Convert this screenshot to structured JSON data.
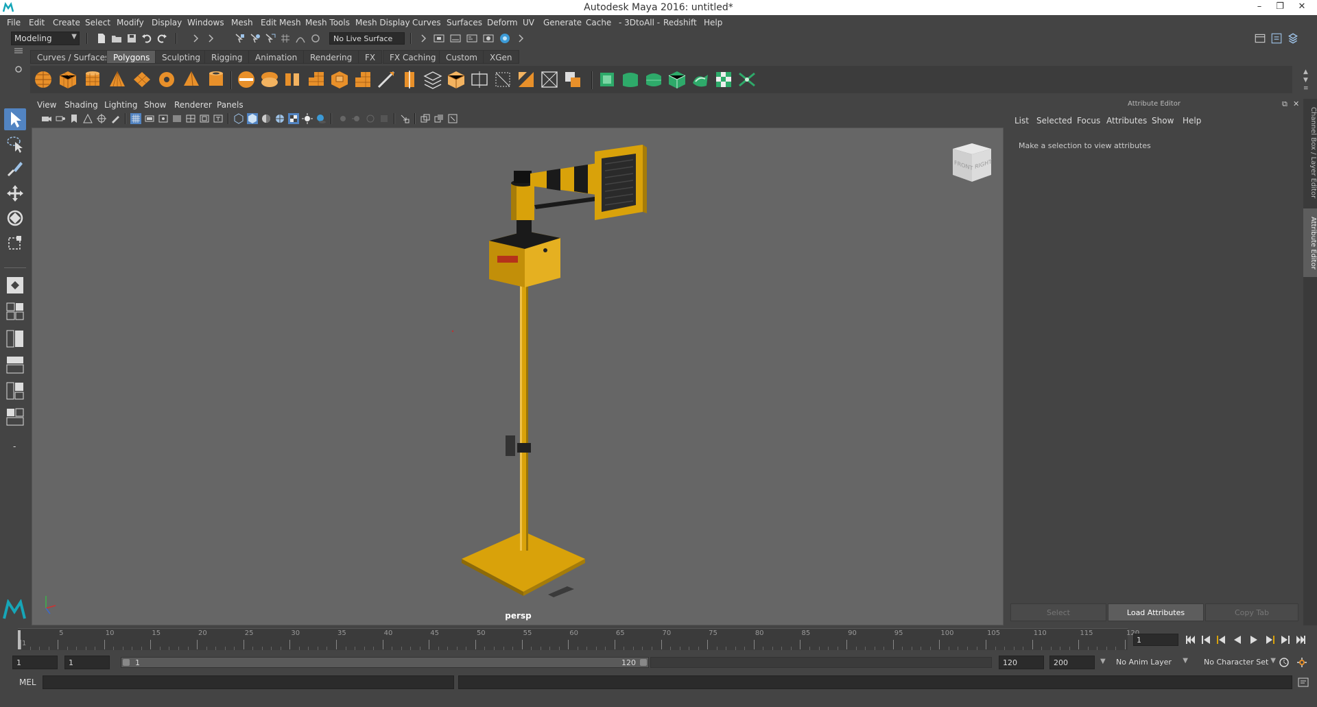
{
  "window": {
    "title": "Autodesk Maya 2016: untitled*"
  },
  "menubar": [
    "File",
    "Edit",
    "Create",
    "Select",
    "Modify",
    "Display",
    "Windows",
    "Mesh",
    "Edit Mesh",
    "Mesh Tools",
    "Mesh Display",
    "Curves",
    "Surfaces",
    "Deform",
    "UV",
    "Generate",
    "Cache",
    "- 3DtoAll -",
    "Redshift",
    "Help"
  ],
  "status": {
    "mode": "Modeling",
    "live_surface": "No Live Surface"
  },
  "shelf": {
    "tabs": [
      "Curves / Surfaces",
      "Polygons",
      "Sculpting",
      "Rigging",
      "Animation",
      "Rendering",
      "FX",
      "FX Caching",
      "Custom",
      "XGen"
    ],
    "active_tab": "Polygons"
  },
  "viewport": {
    "menu": [
      "View",
      "Shading",
      "Lighting",
      "Show",
      "Renderer",
      "Panels"
    ],
    "camera": "persp",
    "viewcube": {
      "front": "FRONT",
      "right": "RIGHT"
    }
  },
  "attribute_editor": {
    "title": "Attribute Editor",
    "menu": [
      "List",
      "Selected",
      "Focus",
      "Attributes",
      "Show",
      "Help"
    ],
    "message": "Make a selection to view attributes",
    "buttons": [
      "Select",
      "Load Attributes",
      "Copy Tab"
    ]
  },
  "side_tabs": [
    "Channel Box / Layer Editor",
    "Attribute Editor"
  ],
  "timeline": {
    "labels": [
      "1",
      "5",
      "10",
      "15",
      "20",
      "25",
      "30",
      "35",
      "40",
      "45",
      "50",
      "55",
      "60",
      "65",
      "70",
      "75",
      "80",
      "85",
      "90",
      "95",
      "100",
      "105",
      "110",
      "115",
      "120"
    ],
    "current_frame": "1"
  },
  "range": {
    "start": "1",
    "playback_start": "1",
    "range_start_label": "1",
    "range_end_label": "120",
    "playback_end": "120",
    "end": "200",
    "anim_layer": "No Anim Layer",
    "character_set": "No Character Set"
  },
  "command": {
    "label": "MEL"
  },
  "colors": {
    "accent": "#5284c2",
    "viewport_bg": "#666666",
    "model_yellow": "#d9a20a"
  }
}
